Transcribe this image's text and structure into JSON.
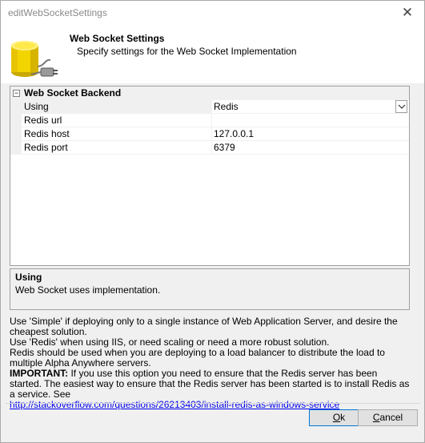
{
  "window": {
    "title": "editWebSocketSettings",
    "close_glyph": "✕"
  },
  "header": {
    "title": "Web Socket Settings",
    "subtitle": "Specify settings for the Web Socket Implementation",
    "icon": "database-plug-icon"
  },
  "grid": {
    "category": {
      "label": "Web Socket Backend",
      "expander": "−"
    },
    "properties": [
      {
        "name": "Using",
        "value": "Redis",
        "has_dropdown": true
      },
      {
        "name": "Redis url",
        "value": ""
      },
      {
        "name": "Redis host",
        "value": "127.0.0.1"
      },
      {
        "name": "Redis port",
        "value": "6379"
      }
    ]
  },
  "description": {
    "title": "Using",
    "text": "Web Socket uses implementation."
  },
  "help": {
    "line1": "Use 'Simple' if deploying only to a single instance of Web Application Server, and desire the cheapest solution.",
    "line2": "Use 'Redis' when using IIS, or need scaling or need a more robust solution.",
    "line3": "Redis should be used when you are deploying to a load balancer to distribute the load to multiple Alpha Anywhere servers.",
    "important_label": "IMPORTANT:",
    "important_text": " If you use this option you need to ensure that the Redis server has been started. The easiest way to ensure that the Redis server has been started is to install Redis as a service. See",
    "link": "http://stackoverflow.com/questions/26213403/install-redis-as-windows-service"
  },
  "buttons": {
    "ok_accel": "O",
    "ok_rest": "k",
    "cancel_accel": "C",
    "cancel_rest": "ancel"
  },
  "colors": {
    "link": "#0000ee",
    "default_button_border": "#0078d7"
  }
}
